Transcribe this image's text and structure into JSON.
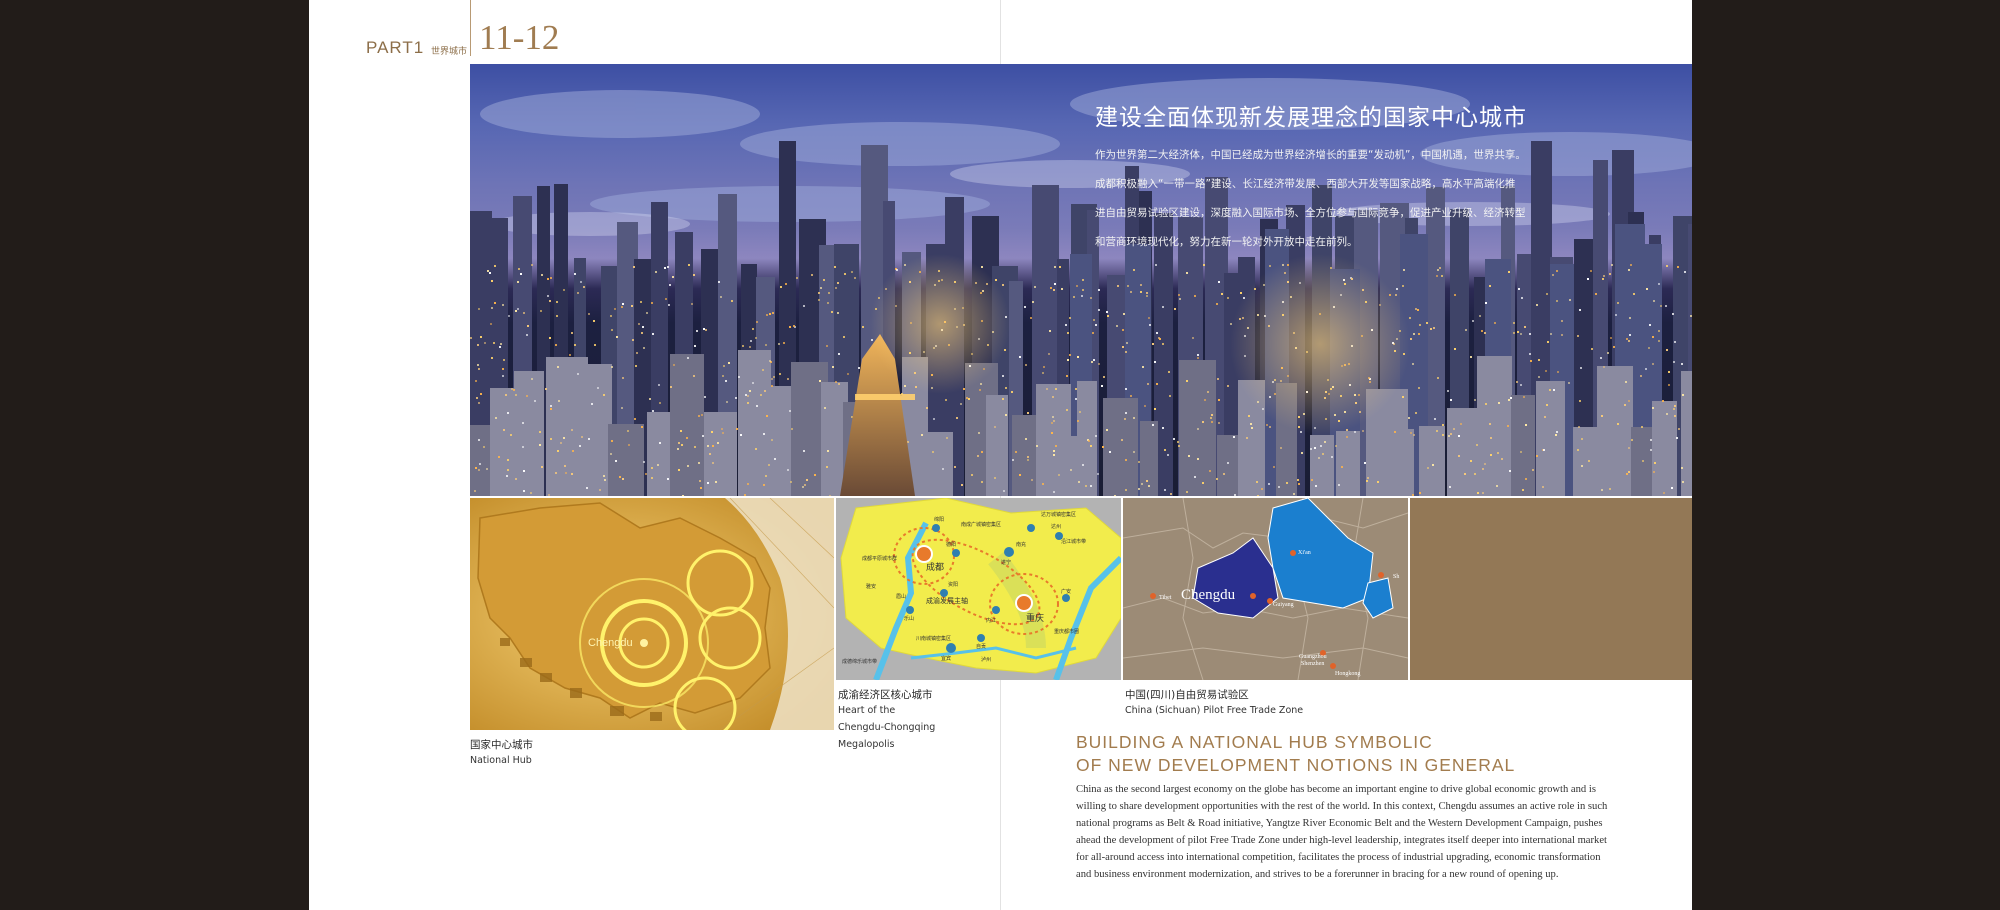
{
  "header": {
    "part": "PART1",
    "section": "世界城市",
    "pages": "11-12"
  },
  "hero": {
    "title": "建设全面体现新发展理念的国家中心城市",
    "paragraph_lines": [
      "作为世界第二大经济体，中国已经成为世界经济增长的重要“发动机”，中国机遇，世界共享。",
      "成都积极融入“一带一路”建设、长江经济带发展、西部大开发等国家战略，高水平高端化推",
      "进自由贸易试验区建设，深度融入国际市场、全方位参与国际竞争，促进产业升级、经济转型",
      "和营商环境现代化，努力在新一轮对外开放中走在前列。"
    ]
  },
  "maps": {
    "china": {
      "city_label": "Chengdu"
    },
    "region": {
      "city1": "成都",
      "city2": "重庆",
      "axis": "成渝发展主轴",
      "small_labels": [
        "绵阳",
        "德阳",
        "遂宁",
        "南充",
        "广安",
        "达州",
        "资阳",
        "内江",
        "自贡",
        "宜宾",
        "泸州",
        "乐山",
        "眉山",
        "雅安"
      ],
      "zone_labels": [
        "南成广城镇密集区",
        "达万城镇密集区",
        "成都平原城市群",
        "沿江城市带",
        "川南城镇密集区",
        "成德绵乐城市带",
        "重庆都市圈"
      ]
    },
    "sichuan": {
      "city_label": "Chengdu",
      "labels": [
        "Tibet",
        "Xi'an",
        "Guiyang",
        "Guangzhou",
        "Shenzhen",
        "Hongkong",
        "Sh"
      ]
    }
  },
  "captions": [
    {
      "cn": "国家中心城市",
      "en_lines": [
        "National Hub"
      ]
    },
    {
      "cn": "成渝经济区核心城市",
      "en_lines": [
        "Heart of the",
        "Chengdu-Chongqing",
        "Megalopolis"
      ]
    },
    {
      "cn": "中国(四川)自由贸易试验区",
      "en_lines": [
        "China (Sichuan) Pilot Free Trade Zone"
      ]
    }
  ],
  "english": {
    "title_lines": [
      "BUILDING A NATIONAL HUB SYMBOLIC",
      "OF NEW DEVELOPMENT NOTIONS IN GENERAL"
    ],
    "body_lines": [
      "China as the second largest economy on the globe has become an important engine to drive global economic growth and is",
      "willing to share development opportunities with the rest of the world. In this context, Chengdu assumes an active role in such",
      "national programs as Belt & Road initiative, Yangtze River Economic Belt and the Western Development Campaign, pushes",
      "ahead the development of pilot Free Trade Zone under high-level leadership, integrates itself deeper into international market",
      "for all-around access into international competition, facilitates the process of industrial upgrading, economic transformation",
      "and business environment modernization, and strives to be a forerunner in bracing for a new round of opening up."
    ]
  },
  "colors": {
    "frame": "#221c19",
    "accent_gold": "#a27c4e",
    "tile_gold": "#937856"
  }
}
